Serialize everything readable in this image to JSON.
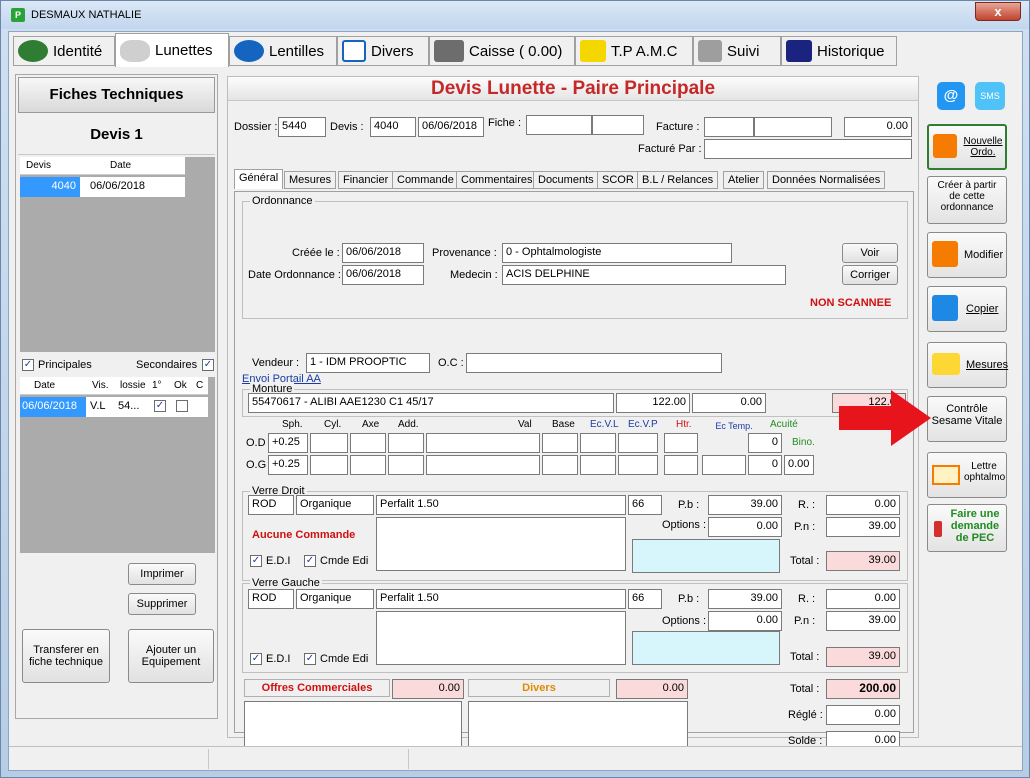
{
  "window": {
    "title": "DESMAUX NATHALIE",
    "app_icon": "P",
    "close": "x"
  },
  "tabs": [
    {
      "label": "Identité",
      "icon": "profile-icon",
      "color": "#2e7d32"
    },
    {
      "label": "Lunettes",
      "icon": "glasses-icon",
      "color": "#888888"
    },
    {
      "label": "Lentilles",
      "icon": "lens-icon",
      "color": "#1565c0"
    },
    {
      "label": "Divers",
      "icon": "list-icon",
      "color": "#1565c0"
    },
    {
      "label": "Caisse ( 0.00)",
      "icon": "register-icon",
      "color": "#555555"
    },
    {
      "label": "T.P A.M.C",
      "icon": "plus-icon",
      "color": "#f5d700"
    },
    {
      "label": "Suivi",
      "icon": "wrench-icon",
      "color": "#555555"
    },
    {
      "label": "Historique",
      "icon": "book-icon",
      "color": "#1565c0"
    }
  ],
  "left": {
    "header": "Fiches Techniques",
    "sub": "Devis 1",
    "devis_cols": [
      "Devis",
      "Date"
    ],
    "devis_rows": [
      {
        "devis": "4040",
        "date": "06/06/2018"
      }
    ],
    "principales": "Principales",
    "secondaires": "Secondaires",
    "ord_cols": [
      "Date",
      "Vis.",
      "lossie",
      "1°",
      "Ok",
      "C"
    ],
    "ord_rows": [
      {
        "date": "06/06/2018",
        "vis": "V.L",
        "dossier": "54...",
        "first": "✓",
        "ok": ""
      }
    ],
    "imprimer": "Imprimer",
    "supprimer": "Supprimer",
    "transferer": "Transferer en fiche technique",
    "ajouter": "Ajouter un Equipement"
  },
  "main": {
    "title": "Devis Lunette - Paire Principale",
    "dossier_label": "Dossier :",
    "dossier": "5440",
    "devis_label": "Devis :",
    "devis": "4040",
    "devis_date": "06/06/2018",
    "fiche_label": "Fiche :",
    "facture_label": "Facture :",
    "facture_amount": "0.00",
    "facture_par_label": "Facturé Par :",
    "subtabs": [
      "Général",
      "Mesures",
      "Financier",
      "Commande",
      "Commentaires",
      "Documents",
      "SCOR",
      "B.L / Relances",
      "Atelier",
      "Données Normalisées"
    ],
    "ordonnance": {
      "legend": "Ordonnance",
      "creee_label": "Créée le :",
      "creee": "06/06/2018",
      "provenance_label": "Provenance :",
      "provenance": "0 - Ophtalmologiste",
      "date_ord_label": "Date Ordonnance :",
      "date_ord": "06/06/2018",
      "medecin_label": "Medecin :",
      "medecin": "ACIS DELPHINE",
      "voir": "Voir",
      "corriger": "Corriger",
      "status": "NON SCANNEE"
    },
    "vendeur_label": "Vendeur :",
    "vendeur": "1 - IDM PROOPTIC",
    "oc_label": "O.C :",
    "envoi": "Envoi Portail AA",
    "monture": {
      "legend": "Monture",
      "ref": "55470617 - ALIBI AAE1230 C1 45/17",
      "price": "122.00",
      "remise": "0.00",
      "total": "122.00"
    },
    "rx_headers": {
      "sph": "Sph.",
      "cyl": "Cyl.",
      "axe": "Axe",
      "add": "Add.",
      "val": "Val",
      "base": "Base",
      "ecvl": "Ec.V.L",
      "ecvp": "Ec.V.P",
      "htr": "Htr.",
      "ectemp": "Ec Temp.",
      "acuite": "Acuité",
      "bino": "Bino."
    },
    "od": {
      "label": "O.D",
      "sph": "+0.25",
      "acuite": "0"
    },
    "og": {
      "label": "O.G",
      "sph": "+0.25",
      "acuite": "0",
      "bino": "0.00"
    },
    "verre_droit": {
      "legend": "Verre Droit",
      "code": "ROD",
      "mat": "Organique",
      "name": "Perfalit 1.50",
      "diam": "66",
      "pb_label": "P.b :",
      "pb": "39.00",
      "r_label": "R. :",
      "r": "0.00",
      "options_label": "Options :",
      "options": "0.00",
      "pn_label": "P.n :",
      "pn": "39.00",
      "total_label": "Total :",
      "total": "39.00",
      "warning": "Aucune Commande",
      "edi": "E.D.I",
      "cmde": "Cmde Edi"
    },
    "verre_gauche": {
      "legend": "Verre Gauche",
      "code": "ROD",
      "mat": "Organique",
      "name": "Perfalit 1.50",
      "diam": "66",
      "pb_label": "P.b :",
      "pb": "39.00",
      "r_label": "R. :",
      "r": "0.00",
      "options_label": "Options :",
      "options": "0.00",
      "pn_label": "P.n :",
      "pn": "39.00",
      "total_label": "Total :",
      "total": "39.00",
      "edi": "E.D.I",
      "cmde": "Cmde Edi"
    },
    "offres": {
      "label": "Offres Commerciales",
      "amount": "0.00"
    },
    "divers": {
      "label": "Divers",
      "amount": "0.00"
    },
    "total_label": "Total :",
    "total": "200.00",
    "regle_label": "Réglé :",
    "regle": "0.00",
    "solde_label": "Solde :",
    "solde": "0.00"
  },
  "right": {
    "nouvelle": "Nouvelle Ordo.",
    "creer": "Créer à partir de cette ordonnance",
    "modifier": "Modifier",
    "copier": "Copier",
    "mesures": "Mesures",
    "controle": "Contrôle Sesame Vitale",
    "lettre": "Lettre ophtalmo",
    "pec": "Faire une demande de PEC",
    "sms": "SMS",
    "at": "@"
  }
}
